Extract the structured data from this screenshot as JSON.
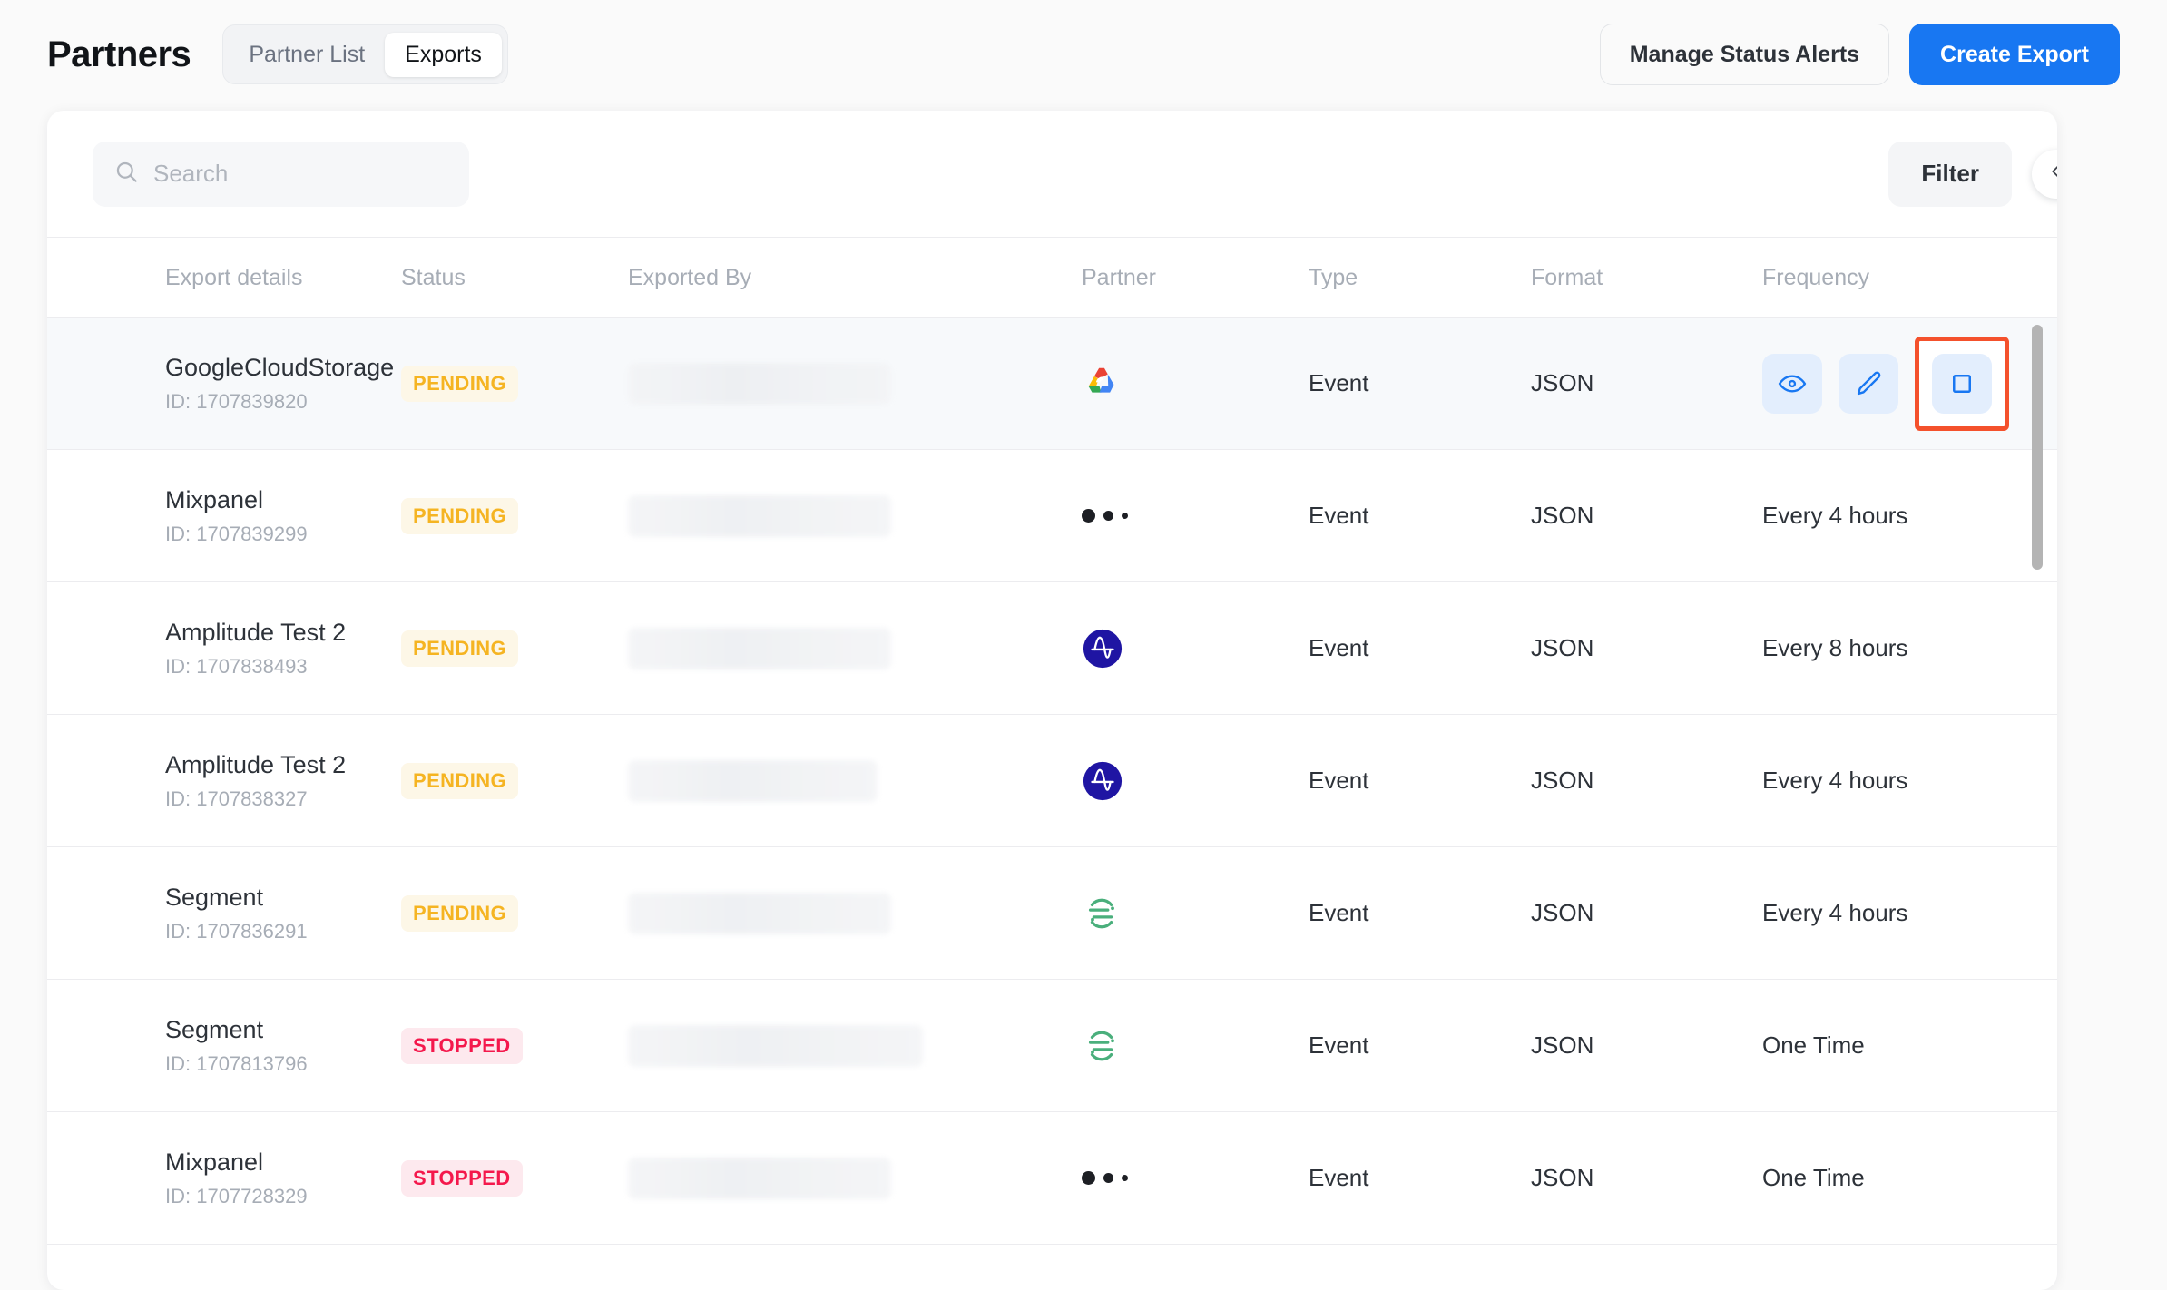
{
  "header": {
    "title": "Partners",
    "tabs": [
      {
        "label": "Partner List",
        "active": false
      },
      {
        "label": "Exports",
        "active": true
      }
    ],
    "manage_alerts_label": "Manage Status Alerts",
    "create_export_label": "Create Export",
    "primary_color": "#1877f2"
  },
  "toolbar": {
    "search_placeholder": "Search",
    "search_value": "",
    "filter_label": "Filter",
    "collapse_icon": "chevron-left-icon"
  },
  "table": {
    "columns": [
      "Export details",
      "Status",
      "Exported By",
      "Partner",
      "Type",
      "Format",
      "Frequency"
    ],
    "rows": [
      {
        "name": "GoogleCloudStorage",
        "id": "ID: 1707839820",
        "status": "PENDING",
        "status_kind": "pending",
        "exported_by": "",
        "partner_icon": "google-cloud-icon",
        "type": "Event",
        "format": "JSON",
        "frequency": "",
        "has_actions": true,
        "highlighted": true
      },
      {
        "name": "Mixpanel",
        "id": "ID: 1707839299",
        "status": "PENDING",
        "status_kind": "pending",
        "exported_by": "",
        "partner_icon": "mixpanel-icon",
        "type": "Event",
        "format": "JSON",
        "frequency": "Every 4 hours",
        "has_actions": false,
        "highlighted": false
      },
      {
        "name": "Amplitude Test 2",
        "id": "ID: 1707838493",
        "status": "PENDING",
        "status_kind": "pending",
        "exported_by": "",
        "partner_icon": "amplitude-icon",
        "type": "Event",
        "format": "JSON",
        "frequency": "Every 8 hours",
        "has_actions": false,
        "highlighted": false
      },
      {
        "name": "Amplitude Test 2",
        "id": "ID: 1707838327",
        "status": "PENDING",
        "status_kind": "pending",
        "exported_by": "",
        "partner_icon": "amplitude-icon",
        "type": "Event",
        "format": "JSON",
        "frequency": "Every 4 hours",
        "has_actions": false,
        "highlighted": false
      },
      {
        "name": "Segment",
        "id": "ID: 1707836291",
        "status": "PENDING",
        "status_kind": "pending",
        "exported_by": "",
        "partner_icon": "segment-icon",
        "type": "Event",
        "format": "JSON",
        "frequency": "Every 4 hours",
        "has_actions": false,
        "highlighted": false
      },
      {
        "name": "Segment",
        "id": "ID: 1707813796",
        "status": "STOPPED",
        "status_kind": "stopped",
        "exported_by": "",
        "partner_icon": "segment-icon",
        "type": "Event",
        "format": "JSON",
        "frequency": "One Time",
        "has_actions": false,
        "highlighted": false
      },
      {
        "name": "Mixpanel",
        "id": "ID: 1707728329",
        "status": "STOPPED",
        "status_kind": "stopped",
        "exported_by": "",
        "partner_icon": "mixpanel-icon",
        "type": "Event",
        "format": "JSON",
        "frequency": "One Time",
        "has_actions": false,
        "highlighted": false
      }
    ],
    "row_actions": [
      {
        "icon": "eye-icon",
        "name": "view-export-button"
      },
      {
        "icon": "pencil-icon",
        "name": "edit-export-button"
      },
      {
        "icon": "stop-square-icon",
        "name": "stop-export-button"
      }
    ]
  },
  "status_colors": {
    "pending_text": "#f5b422",
    "pending_bg": "#fdf7e7",
    "stopped_text": "#f4184c",
    "stopped_bg": "#fde9ee"
  },
  "annotation": {
    "highlight_color": "#f4512c",
    "target": "stop-export-button"
  }
}
